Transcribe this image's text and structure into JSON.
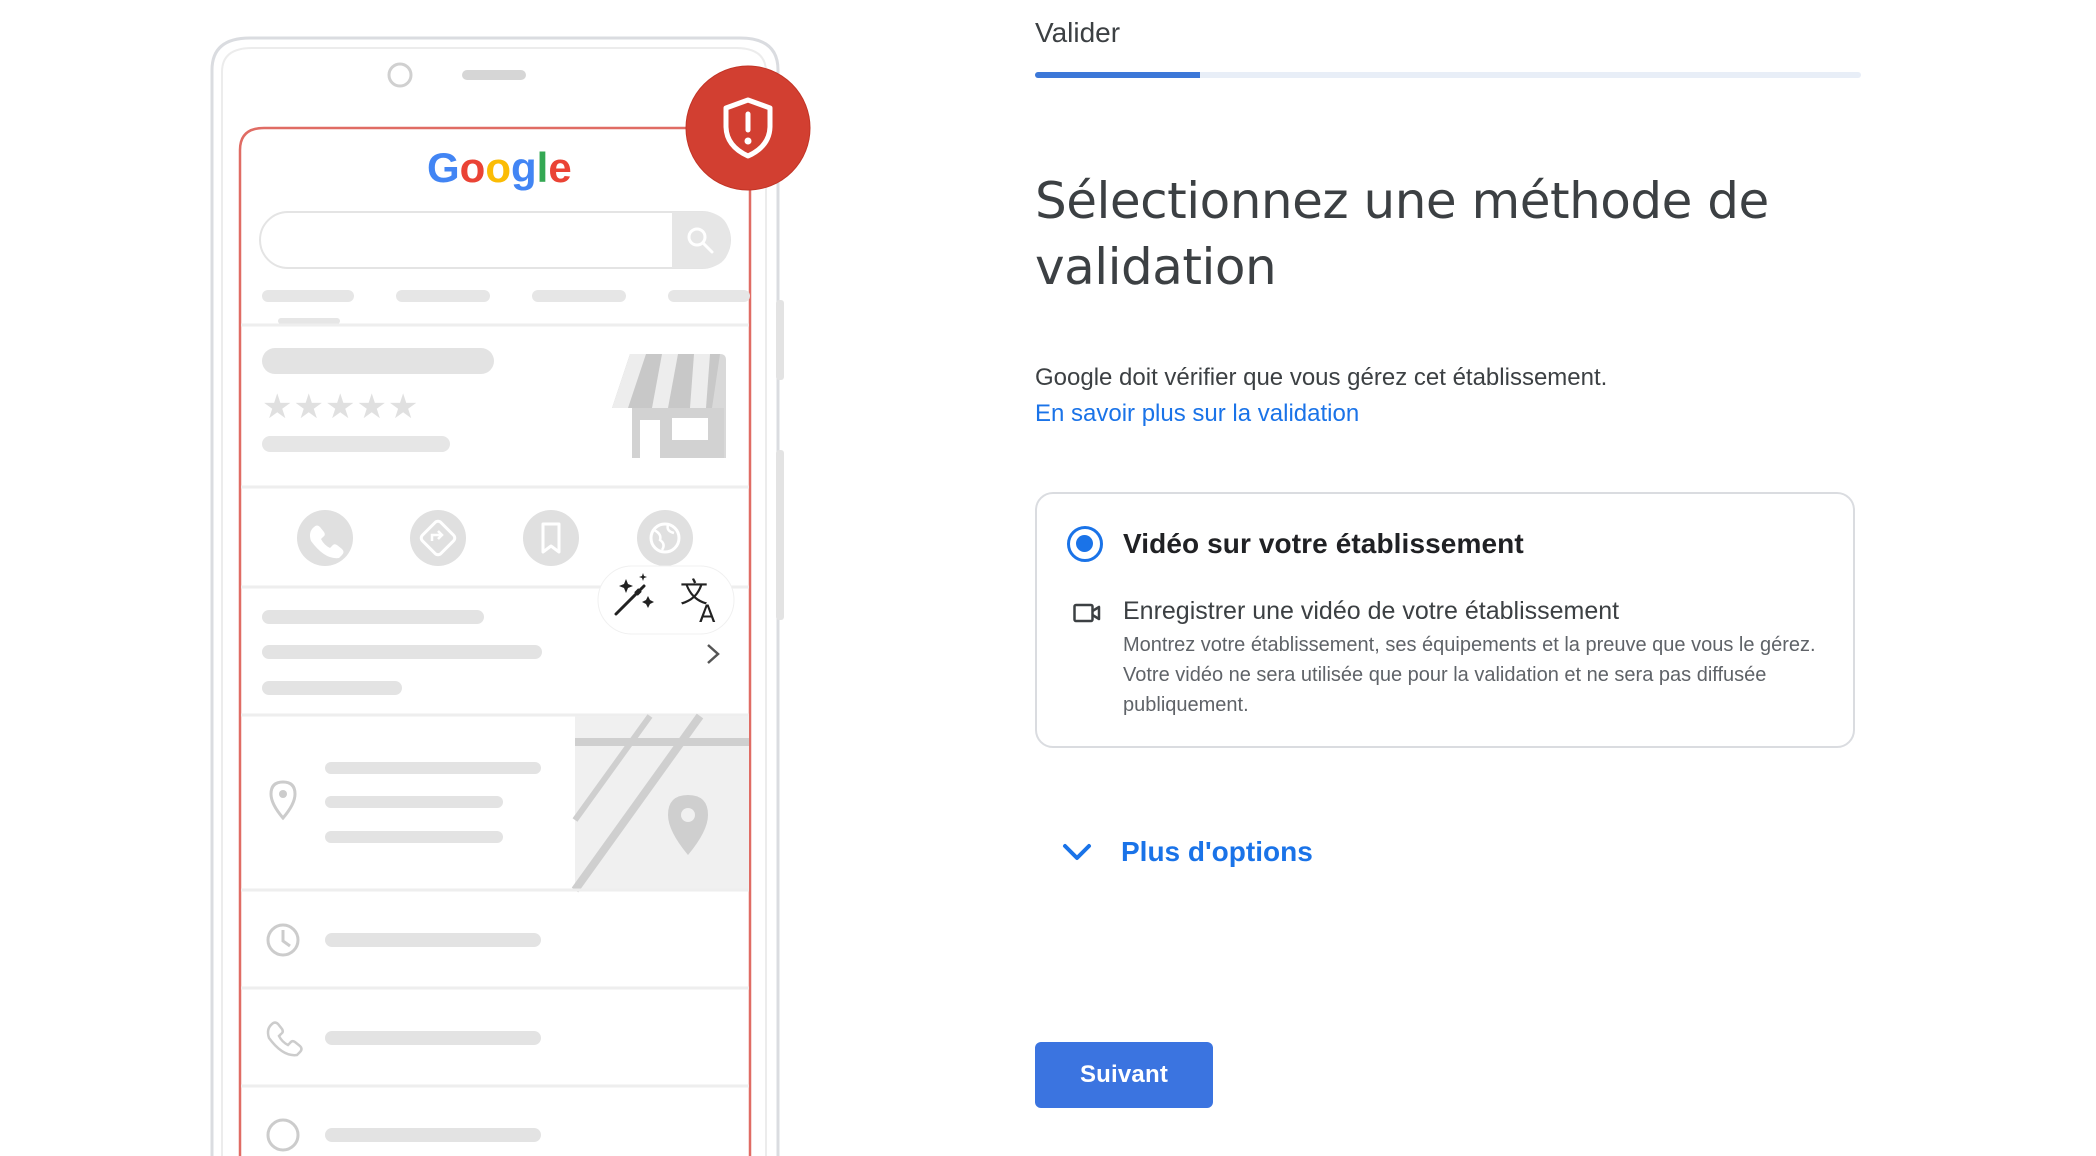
{
  "stepper": {
    "label": "Valider",
    "progress": 0.2
  },
  "phone_illustration": {
    "logo_text": "Google",
    "rating_stars": "★★★★★",
    "alert_icon": "shield-alert-icon",
    "alert_color": "#d23f31",
    "frame_accent_color": "#e06c64",
    "floating_tools": {
      "magic_icon": "magic-wand-icon",
      "translate_icon": "translate-icon"
    },
    "action_icons": [
      "phone-icon",
      "directions-icon",
      "bookmark-icon",
      "globe-icon"
    ],
    "info_icons": [
      "location-pin-icon",
      "clock-icon",
      "phone-icon",
      "globe-icon"
    ]
  },
  "main": {
    "title": "Sélectionnez une méthode de validation",
    "description": "Google doit vérifier que vous gérez cet établissement.",
    "learn_more_link": "En savoir plus sur la validation"
  },
  "option": {
    "title": "Vidéo sur votre établissement",
    "selected": true,
    "subtitle": "Enregistrer une vidéo de votre établissement",
    "body": "Montrez votre établissement, ses équipements et la preuve que vous le gérez. Votre vidéo ne sera utilisée que pour la validation et ne sera pas diffusée publiquement.",
    "icon": "videocam-icon"
  },
  "more_options": {
    "label": "Plus d'options",
    "icon": "chevron-down-icon"
  },
  "footer": {
    "next_label": "Suivant"
  },
  "colors": {
    "accent": "#1a73e8",
    "button": "#3b74e0",
    "text": "#3c4043"
  }
}
